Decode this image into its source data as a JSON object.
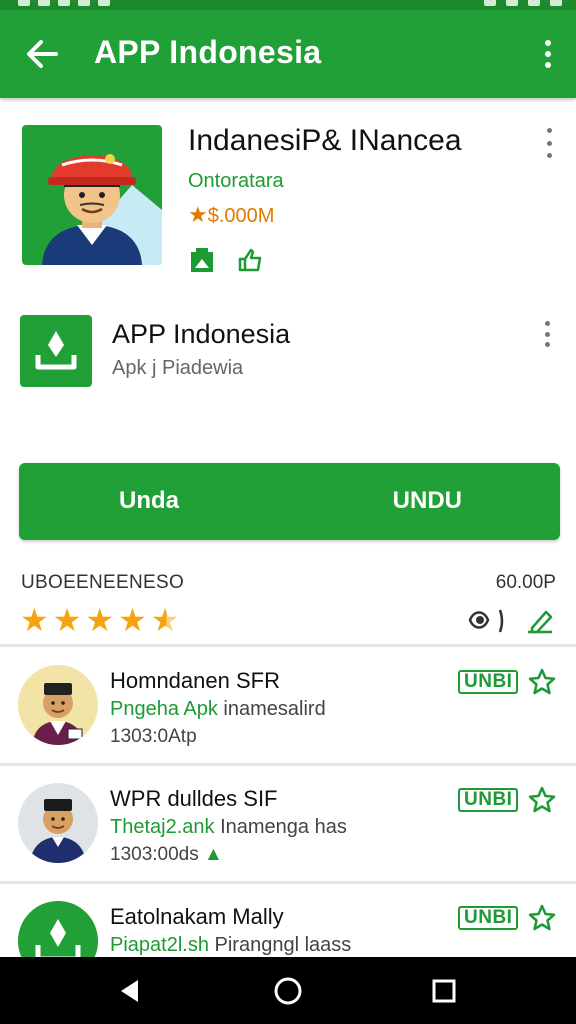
{
  "app_bar": {
    "title": "APP Indonesia"
  },
  "hero": {
    "title": "IndanesiP& INancea",
    "developer": "Ontoratara",
    "rating_text": "$.000M"
  },
  "app_row": {
    "name": "APP Indonesia",
    "subtitle": "Apk j Piadewia"
  },
  "install_button": {
    "left_label": "Unda",
    "right_label": "UNDU"
  },
  "rating_section": {
    "label": "UBOEENEENESO",
    "count": "60.00P",
    "stars": 4.5
  },
  "list": [
    {
      "line1": "Homndanen SFR",
      "line2_green": "Pngeha Apk",
      "line2_rest": " inamesalird",
      "line3": "1303:0Atp",
      "badge": "UNBI"
    },
    {
      "line1": "WPR dulldes SIF",
      "line2_green": "Thetaj2.ank",
      "line2_rest": " Inamenga has",
      "line3": "1303:00ds",
      "badge": "UNBI"
    },
    {
      "line1": "Eatolnakam Mally",
      "line2_green": "Piapat2l.sh",
      "line2_rest": " Pirangngl laass",
      "line3": "",
      "badge": "UNBI"
    }
  ],
  "colors": {
    "brand_green": "#21a038",
    "dark_green": "#1e9a34",
    "star_orange": "#f5a40d"
  }
}
